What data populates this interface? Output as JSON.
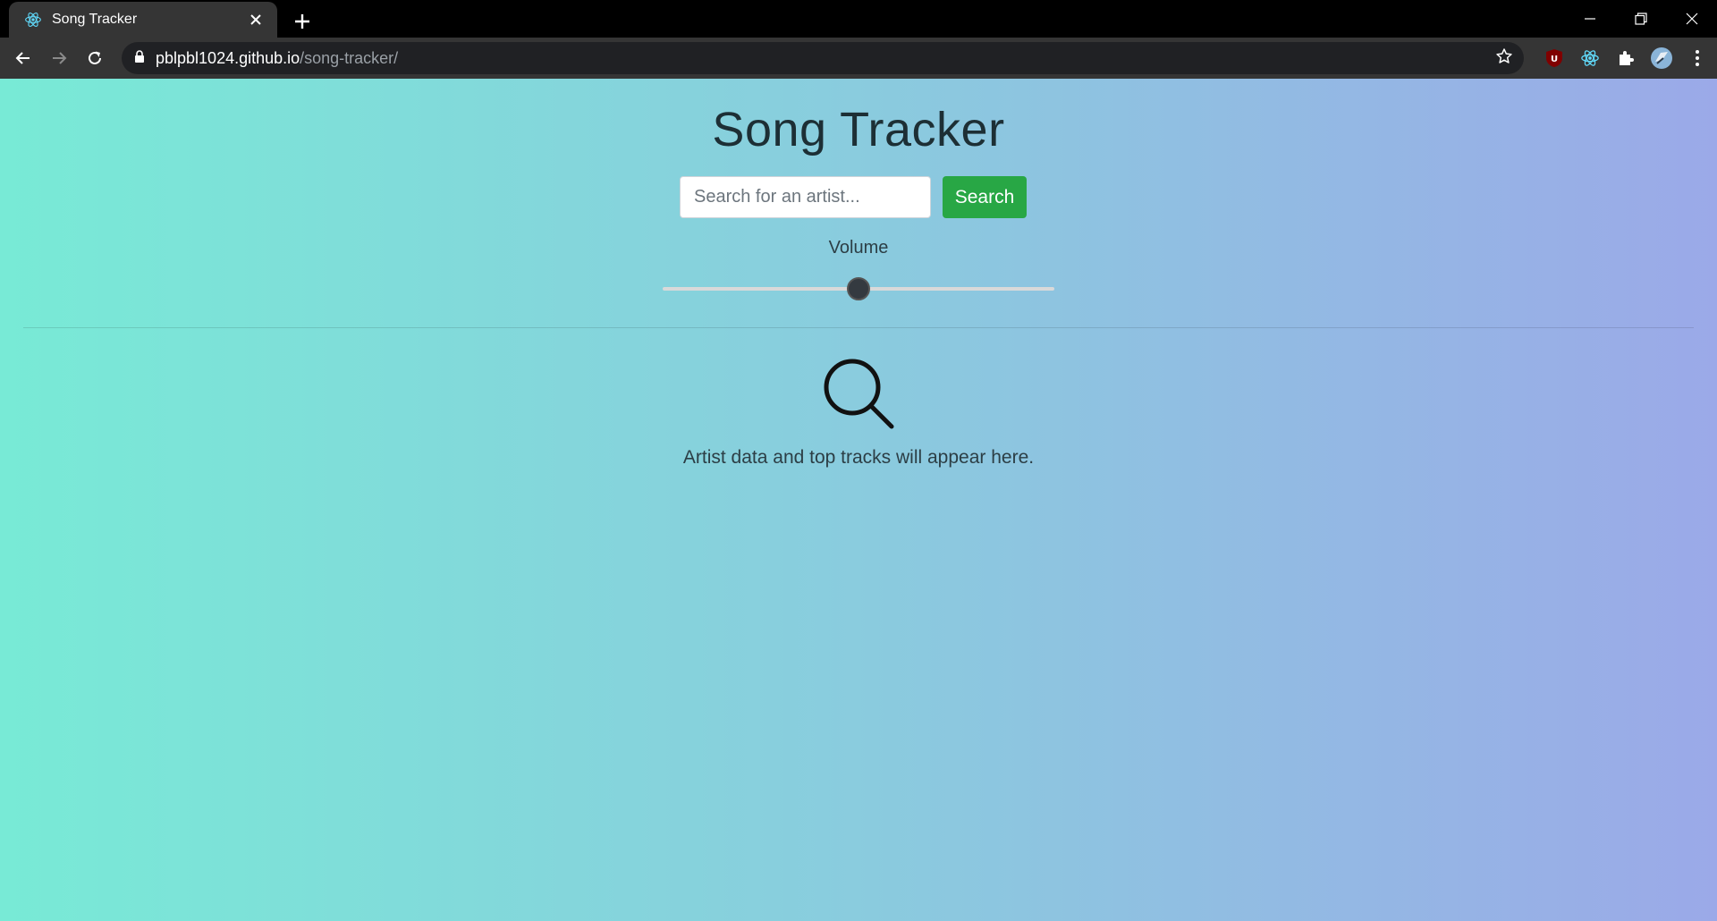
{
  "browser": {
    "tab_title": "Song Tracker",
    "url_host": "pblpbl1024.github.io",
    "url_path": "/song-tracker/",
    "extensions": [
      "ublock-icon",
      "react-devtools-icon",
      "puzzle-icon",
      "profile-avatar"
    ]
  },
  "app": {
    "title": "Song Tracker",
    "search": {
      "placeholder": "Search for an artist...",
      "button_label": "Search"
    },
    "volume": {
      "label": "Volume",
      "value": 0.5
    },
    "empty_state": {
      "icon": "search-icon",
      "message": "Artist data and top tracks will appear here."
    }
  },
  "colors": {
    "button_green": "#28a745",
    "gradient_start": "#78ead6",
    "gradient_end": "#9ba9e8"
  }
}
